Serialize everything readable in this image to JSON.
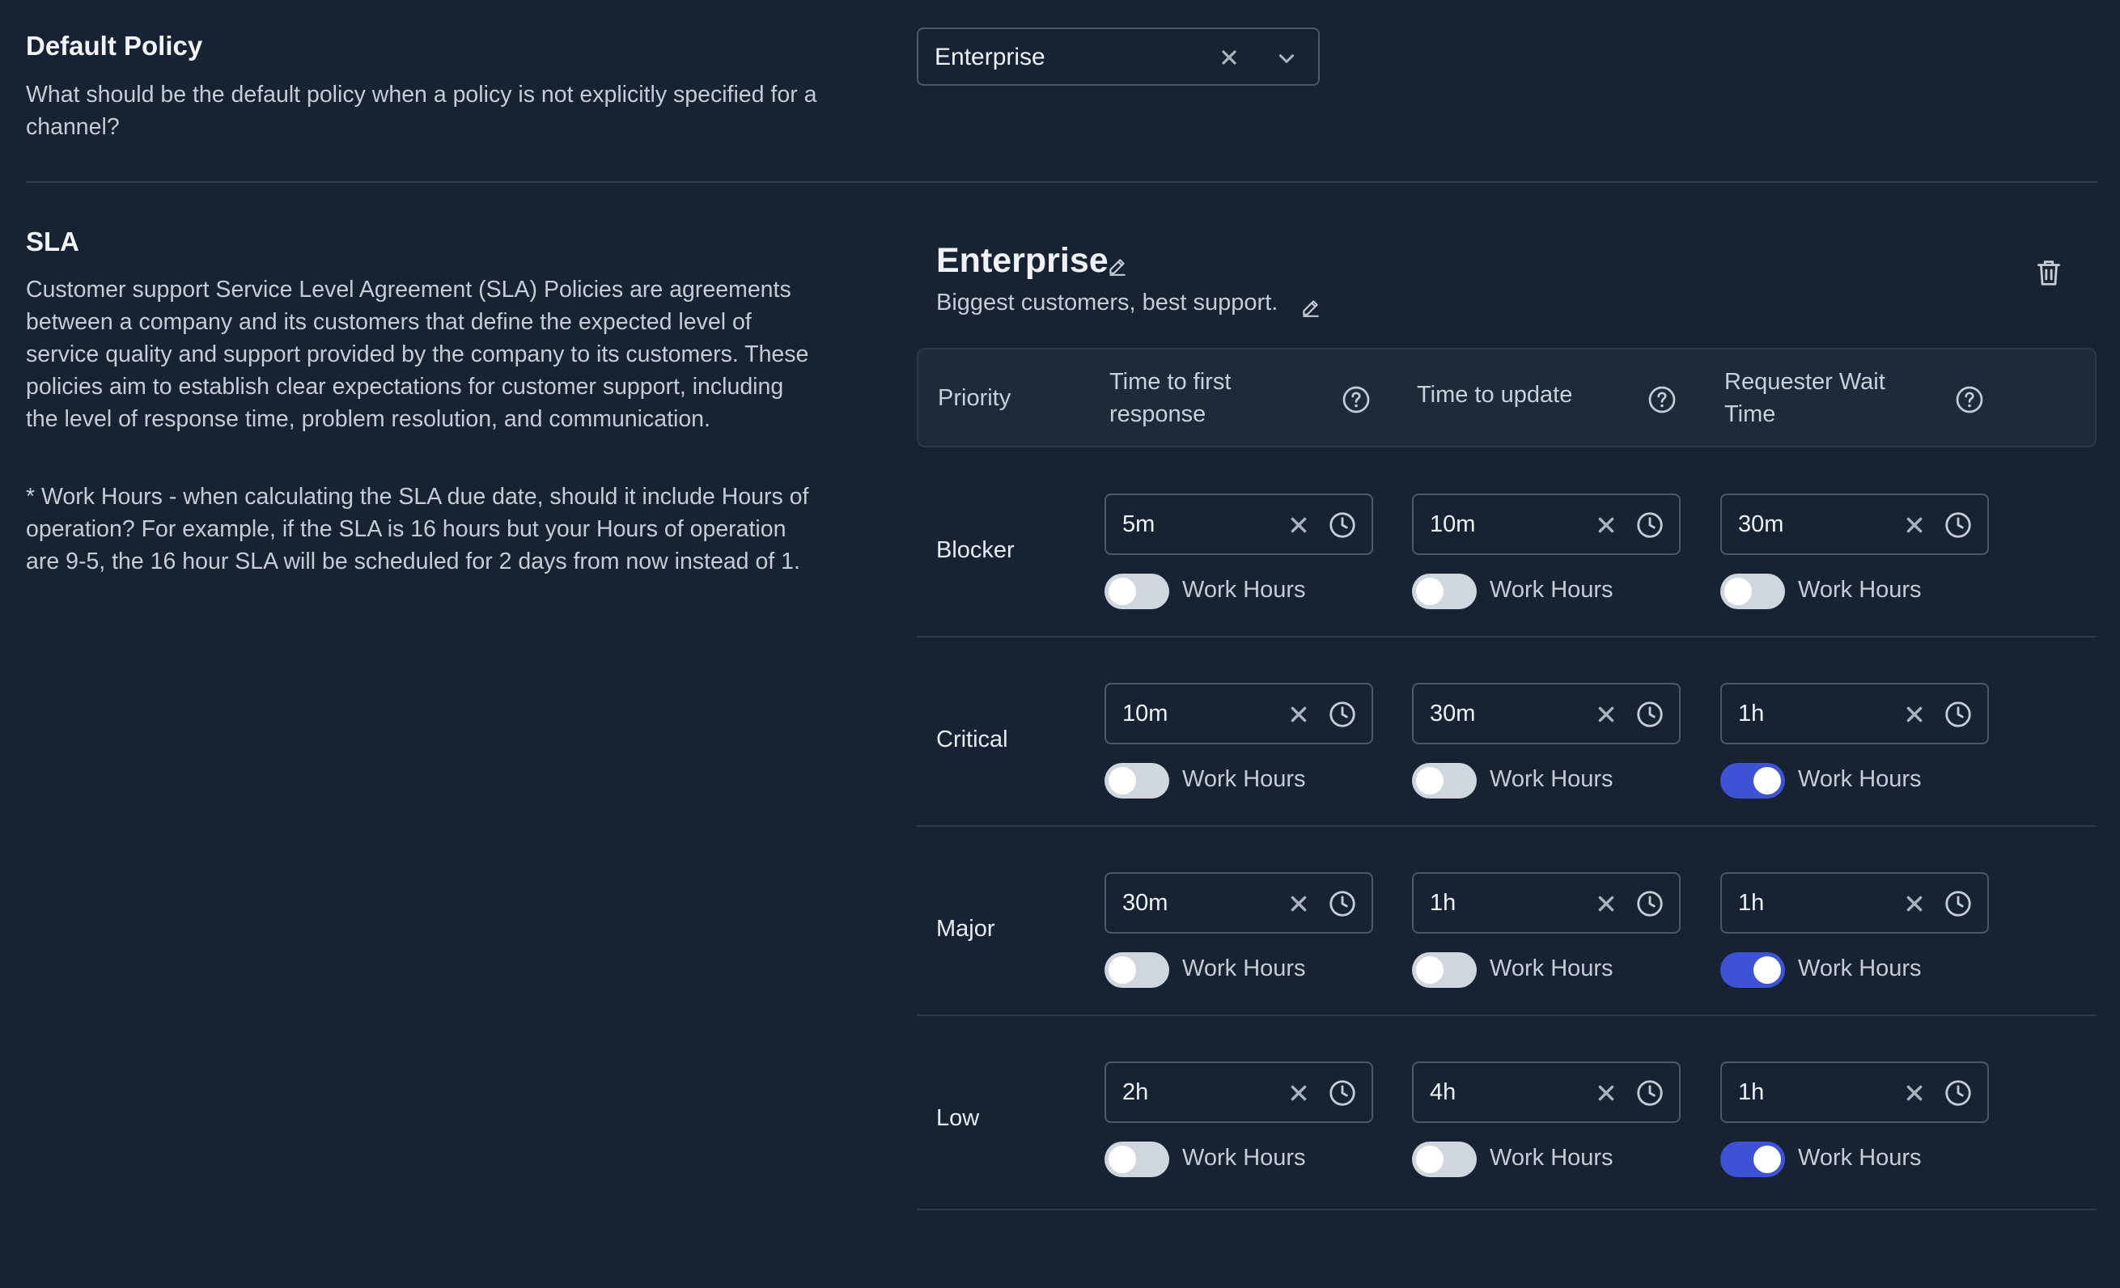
{
  "default_policy": {
    "title": "Default Policy",
    "description": "What should be the default policy when a policy is not explicitly specified for a channel?",
    "selected": "Enterprise"
  },
  "sla": {
    "title": "SLA",
    "description": "Customer support Service Level Agreement (SLA) Policies are agreements between a company and its customers that define the expected level of service quality and support provided by the company to its customers. These policies aim to establish clear expectations for customer support, including the level of response time, problem resolution, and communication.",
    "note": "* Work Hours - when calculating the SLA due date, should it include Hours of operation? For example, if the SLA is 16 hours but your Hours of operation are 9-5, the 16 hour SLA will be scheduled for 2 days from now instead of 1."
  },
  "policy": {
    "name": "Enterprise",
    "description": "Biggest customers, best support.",
    "columns": [
      "Priority",
      "Time to first response",
      "Time to update",
      "Requester Wait Time"
    ],
    "work_hours_label": "Work Hours",
    "rows": [
      {
        "priority": "Blocker",
        "values": [
          "5m",
          "10m",
          "30m"
        ],
        "work_hours": [
          false,
          false,
          false
        ]
      },
      {
        "priority": "Critical",
        "values": [
          "10m",
          "30m",
          "1h"
        ],
        "work_hours": [
          false,
          false,
          true
        ]
      },
      {
        "priority": "Major",
        "values": [
          "30m",
          "1h",
          "1h"
        ],
        "work_hours": [
          false,
          false,
          true
        ]
      },
      {
        "priority": "Low",
        "values": [
          "2h",
          "4h",
          "1h"
        ],
        "work_hours": [
          false,
          false,
          true
        ]
      }
    ]
  },
  "colors": {
    "background": "#172332",
    "toggle_on": "#3d52d5",
    "toggle_off": "#cfd6de"
  },
  "icons": [
    "close-icon",
    "chevron-down-icon",
    "pencil-icon",
    "trash-icon",
    "help-circle-icon",
    "clock-icon"
  ]
}
